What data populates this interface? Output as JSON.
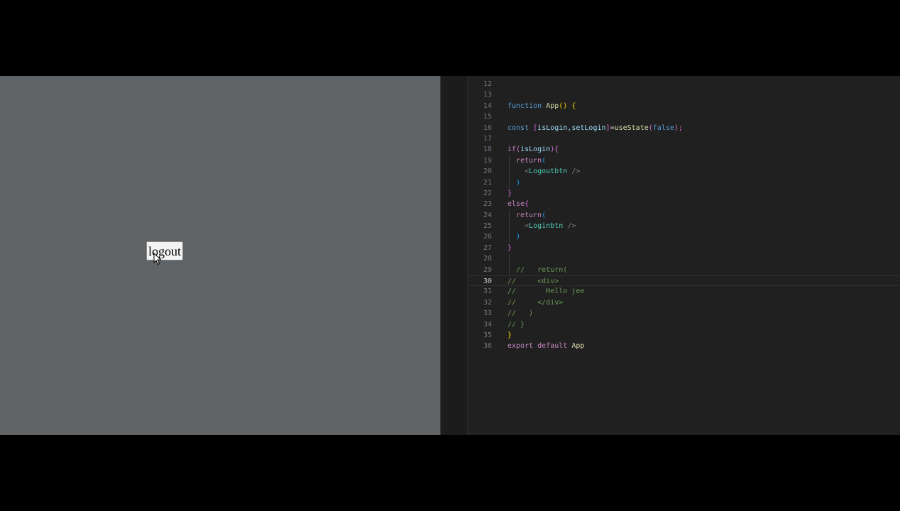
{
  "preview": {
    "logout_button": "logout"
  },
  "editor": {
    "line_numbers": [
      "12",
      "13",
      "14",
      "15",
      "16",
      "17",
      "18",
      "19",
      "20",
      "21",
      "22",
      "23",
      "24",
      "25",
      "26",
      "27",
      "28",
      "29",
      "30",
      "31",
      "32",
      "33",
      "34",
      "35",
      "36"
    ],
    "active_line": "30",
    "code": {
      "l14": [
        "function",
        "App",
        "()",
        " {"
      ],
      "l16": [
        "const",
        "[",
        "isLogin",
        ",setLogin",
        "]",
        "=",
        "useState",
        "(",
        "false",
        ");"
      ],
      "l18": [
        "if",
        "(",
        "isLogin",
        ")",
        "{"
      ],
      "l19": [
        "return",
        "("
      ],
      "l20": [
        "<",
        "Logoutbtn",
        " />"
      ],
      "l21": [
        ")"
      ],
      "l22": [
        "}"
      ],
      "l23": [
        "else",
        "{"
      ],
      "l24": [
        "return",
        "("
      ],
      "l25": [
        "<",
        "Loginbtn",
        " />"
      ],
      "l26": [
        ")"
      ],
      "l27": [
        "}"
      ],
      "l29": "//   return(",
      "l30": "//     <div>",
      "l31": "//       Hello jee",
      "l32": "//     </div>",
      "l33": "//   )",
      "l34": "// }",
      "l35": [
        "}"
      ],
      "l36": [
        "export",
        "default",
        "App"
      ]
    }
  }
}
